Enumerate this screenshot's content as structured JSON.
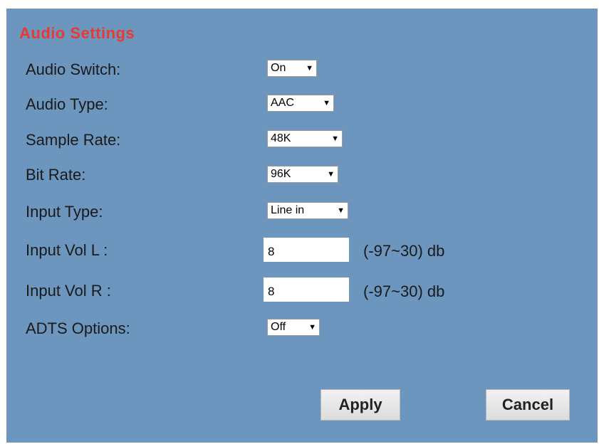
{
  "page": {
    "title": "Audio Settings"
  },
  "fields": {
    "audio_switch": {
      "label": "Audio Switch:",
      "value": "On"
    },
    "audio_type": {
      "label": "Audio Type:",
      "value": "AAC"
    },
    "sample_rate": {
      "label": "Sample Rate:",
      "value": "48K  "
    },
    "bit_rate": {
      "label": "Bit Rate:",
      "value": "96K  "
    },
    "input_type": {
      "label": "Input Type:",
      "value": "Line in"
    },
    "input_vol_l": {
      "label": "Input Vol L :",
      "value": "8",
      "range": "(-97~30) db"
    },
    "input_vol_r": {
      "label": "Input Vol R :",
      "value": "8",
      "range": "(-97~30) db"
    },
    "adts_options": {
      "label": "ADTS Options:",
      "value": "Off"
    }
  },
  "buttons": {
    "apply": "Apply",
    "cancel": "Cancel"
  },
  "icons": {
    "dropdown": "triangle-down-icon"
  },
  "colors": {
    "panel_bg": "#6c96be",
    "title": "#e63a32"
  }
}
